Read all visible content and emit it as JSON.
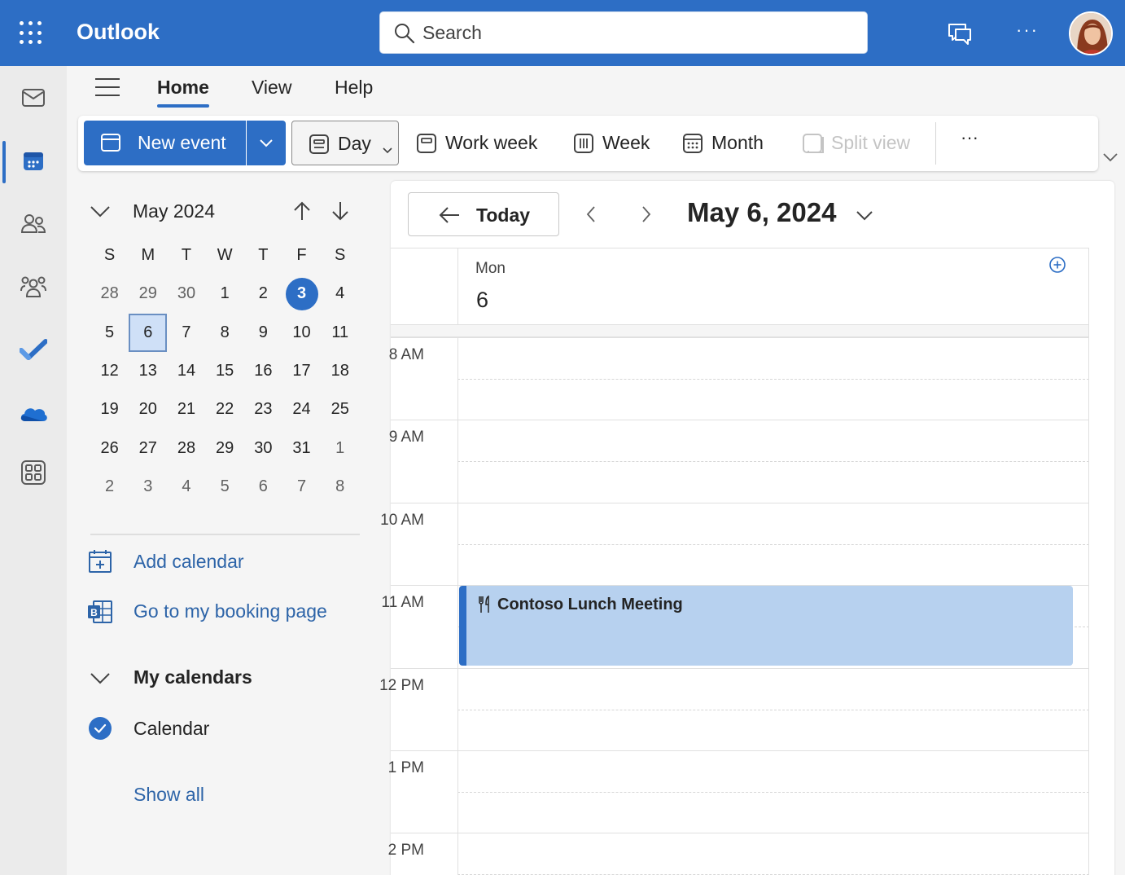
{
  "app": {
    "title": "Outlook"
  },
  "search": {
    "placeholder": "Search"
  },
  "ribbon": {
    "tabs": [
      "Home",
      "View",
      "Help"
    ],
    "active_tab": "Home",
    "new_event_label": "New event",
    "day_label": "Day",
    "work_week_label": "Work week",
    "week_label": "Week",
    "month_label": "Month",
    "split_view_label": "Split view",
    "more_label": "···"
  },
  "rail": {
    "items": [
      "mail-icon",
      "calendar-icon",
      "people-icon",
      "groups-icon",
      "todo-icon",
      "onedrive-icon",
      "apps-icon"
    ],
    "active": "calendar-icon"
  },
  "mini_calendar": {
    "title": "May 2024",
    "day_headers": [
      "S",
      "M",
      "T",
      "W",
      "T",
      "F",
      "S"
    ],
    "weeks": [
      [
        "28",
        "29",
        "30",
        "1",
        "2",
        "3",
        "4"
      ],
      [
        "5",
        "6",
        "7",
        "8",
        "9",
        "10",
        "11"
      ],
      [
        "12",
        "13",
        "14",
        "15",
        "16",
        "17",
        "18"
      ],
      [
        "19",
        "20",
        "21",
        "22",
        "23",
        "24",
        "25"
      ],
      [
        "26",
        "27",
        "28",
        "29",
        "30",
        "31",
        "1"
      ],
      [
        "2",
        "3",
        "4",
        "5",
        "6",
        "7",
        "8"
      ]
    ],
    "today": "3",
    "selected": "6"
  },
  "links": {
    "add_calendar": "Add calendar",
    "booking_page": "Go to my booking page"
  },
  "my_calendars": {
    "title": "My calendars",
    "items": [
      {
        "label": "Calendar",
        "checked": true
      }
    ],
    "show_all": "Show all"
  },
  "main": {
    "today_label": "Today",
    "date_title": "May 6, 2024",
    "day_of_week": "Mon",
    "day_number": "6",
    "hours": [
      "8 AM",
      "9 AM",
      "10 AM",
      "11 AM",
      "12 PM",
      "1 PM",
      "2 PM"
    ],
    "event": {
      "title": "Contoso Lunch Meeting",
      "start": "11 AM",
      "icon": "utensils-icon"
    }
  },
  "colors": {
    "brand": "#2d6ec5",
    "event_fill": "#b7d1ef",
    "link": "#2d64a8"
  }
}
